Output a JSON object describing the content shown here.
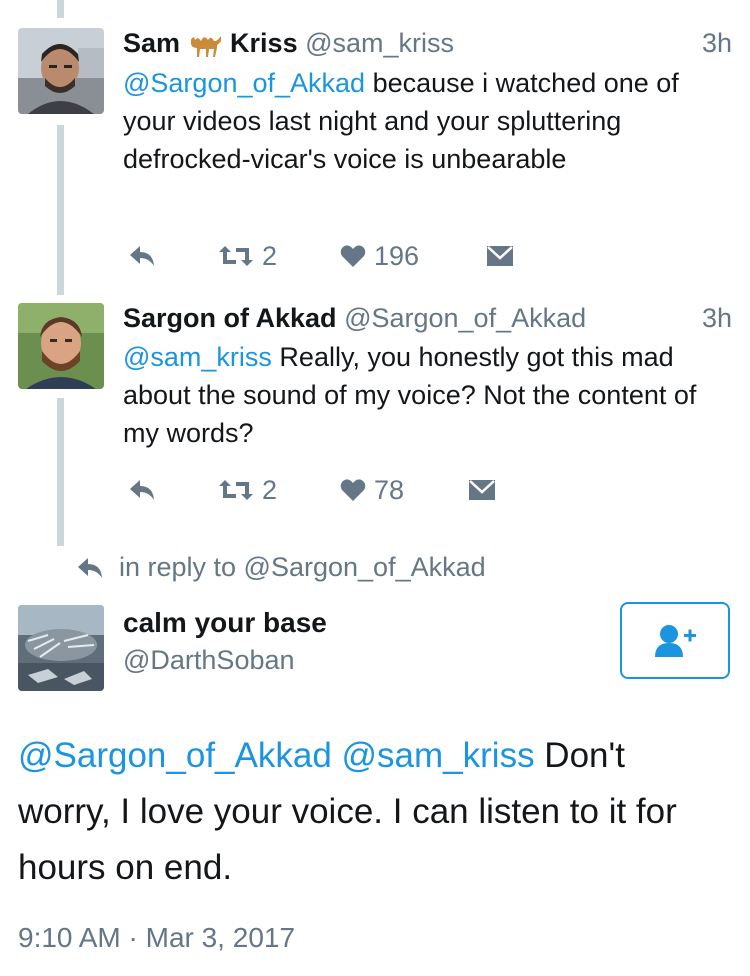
{
  "tweets": [
    {
      "name_first": "Sam",
      "name_emoji": "camel-emoji",
      "name_last": "Kriss",
      "handle": "@sam_kriss",
      "time": "3h",
      "mention": "@Sargon_of_Akkad",
      "text": " because i watched one of your videos last night and your spluttering defrocked-vicar's voice is unbearable",
      "retweets": "2",
      "likes": "196"
    },
    {
      "name": "Sargon of Akkad",
      "handle": "@Sargon_of_Akkad",
      "time": "3h",
      "mention": "@sam_kriss",
      "text": " Really, you honestly got this mad about the sound of my voice? Not the content of my words?",
      "retweets": "2",
      "likes": "78"
    }
  ],
  "reply_context": "in reply to @Sargon_of_Akkad",
  "main_tweet": {
    "name": "calm your base",
    "handle": "@DarthSoban",
    "mention1": "@Sargon_of_Akkad",
    "mention2": "@sam_kriss",
    "text": " Don't worry, I love your voice. I can listen to it for hours on end.",
    "timestamp": "9:10 AM · Mar 3, 2017"
  },
  "colors": {
    "link": "#1b95e0",
    "secondary": "#657786",
    "thread_line": "#ccd6dd",
    "text": "#14171a"
  }
}
